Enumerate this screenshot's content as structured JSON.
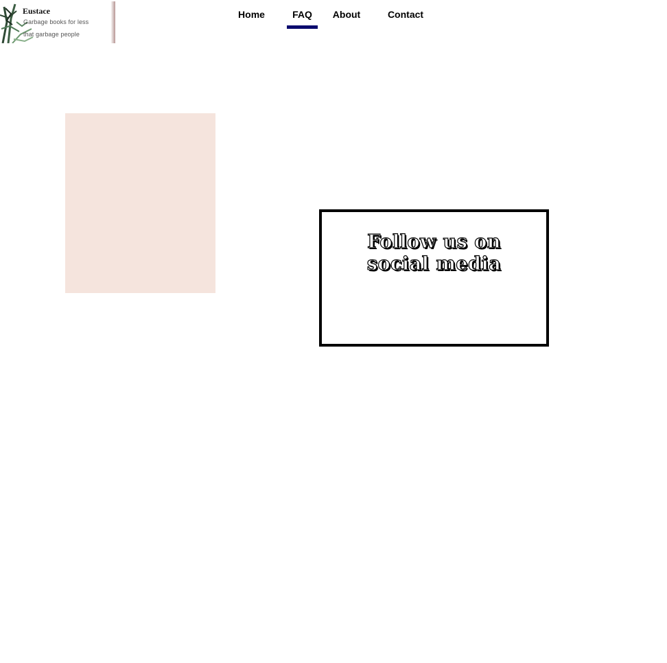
{
  "logo": {
    "title": "Eustace",
    "tagline_line1": "Garbage books for less",
    "tagline_line2": "that garbage people",
    "icon": "plant-logo-icon"
  },
  "nav": {
    "items": [
      {
        "label": "Home"
      },
      {
        "label": "FAQ",
        "active": true
      },
      {
        "label": "About"
      },
      {
        "label": "Contact"
      }
    ],
    "active_indicator_color": "#0a0a6e"
  },
  "panel": {
    "color": "#f5e4dd"
  },
  "social": {
    "heading_line1": "Follow us on",
    "heading_line2": "social media"
  }
}
